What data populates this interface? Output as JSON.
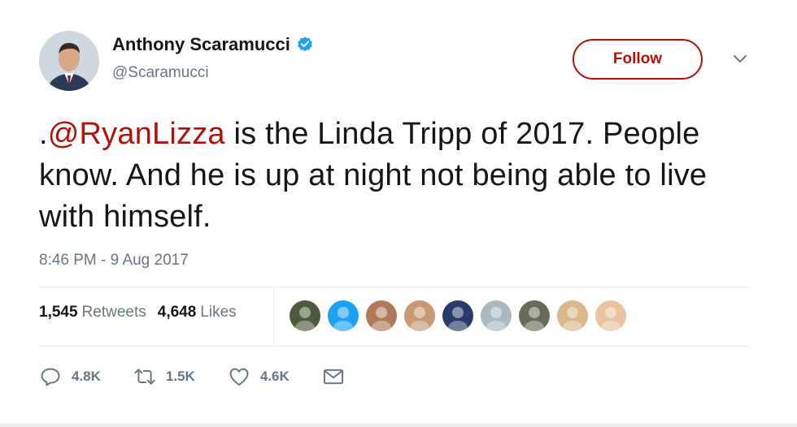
{
  "author": {
    "name": "Anthony Scaramucci",
    "handle": "@Scaramucci",
    "verified_icon": "verified-badge-icon"
  },
  "follow_label": "Follow",
  "tweet": {
    "prefix": ".",
    "mention": "@RyanLizza",
    "body": " is the Linda Tripp of 2017. People know. And he is up at night not being able to live with himself."
  },
  "timestamp": "8:46 PM - 9 Aug 2017",
  "stats": {
    "retweets_count": "1,545",
    "retweets_label": "Retweets",
    "likes_count": "4,648",
    "likes_label": "Likes"
  },
  "liker_avatars": [
    "#4a5a3a",
    "#1da1f2",
    "#b07a5a",
    "#c79a74",
    "#2a3a6a",
    "#aab8c2",
    "#6a6a5a",
    "#d8b88a",
    "#e8c4a0"
  ],
  "actions": {
    "reply_count": "4.8K",
    "retweet_count": "1.5K",
    "like_count": "4.6K"
  },
  "colors": {
    "accent": "#b0120a",
    "secondary_text": "#657786",
    "verified": "#1da1f2"
  }
}
